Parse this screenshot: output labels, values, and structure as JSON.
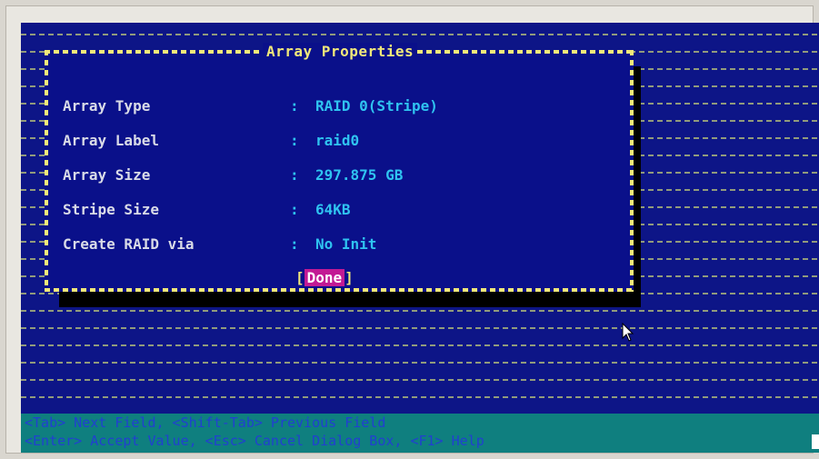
{
  "dialog": {
    "title": "Array Properties",
    "rows": [
      {
        "label": "Array Type",
        "colon": ":",
        "value": "RAID 0(Stripe)"
      },
      {
        "label": "Array Label",
        "colon": ":",
        "value": "raid0"
      },
      {
        "label": "Array Size",
        "colon": ":",
        "value": "297.875 GB"
      },
      {
        "label": "Stripe Size",
        "colon": ":",
        "value": "64KB"
      },
      {
        "label": "Create RAID via",
        "colon": ":",
        "value": "No Init"
      }
    ],
    "done_open": "[",
    "done_label": "Done",
    "done_close": "]"
  },
  "help": {
    "line1": "<Tab> Next Field, <Shift-Tab> Previous Field",
    "line2": "<Enter> Accept Value, <Esc> Cancel Dialog Box, <F1> Help"
  },
  "colors": {
    "screen_bg": "#0d1587",
    "accent_yellow": "#f1e87a",
    "value_cyan": "#2fc3f0",
    "button_magenta": "#c21a94",
    "helpbar_teal": "#0f7f7f"
  },
  "icons": {
    "pointer": "mouse-pointer-icon"
  }
}
